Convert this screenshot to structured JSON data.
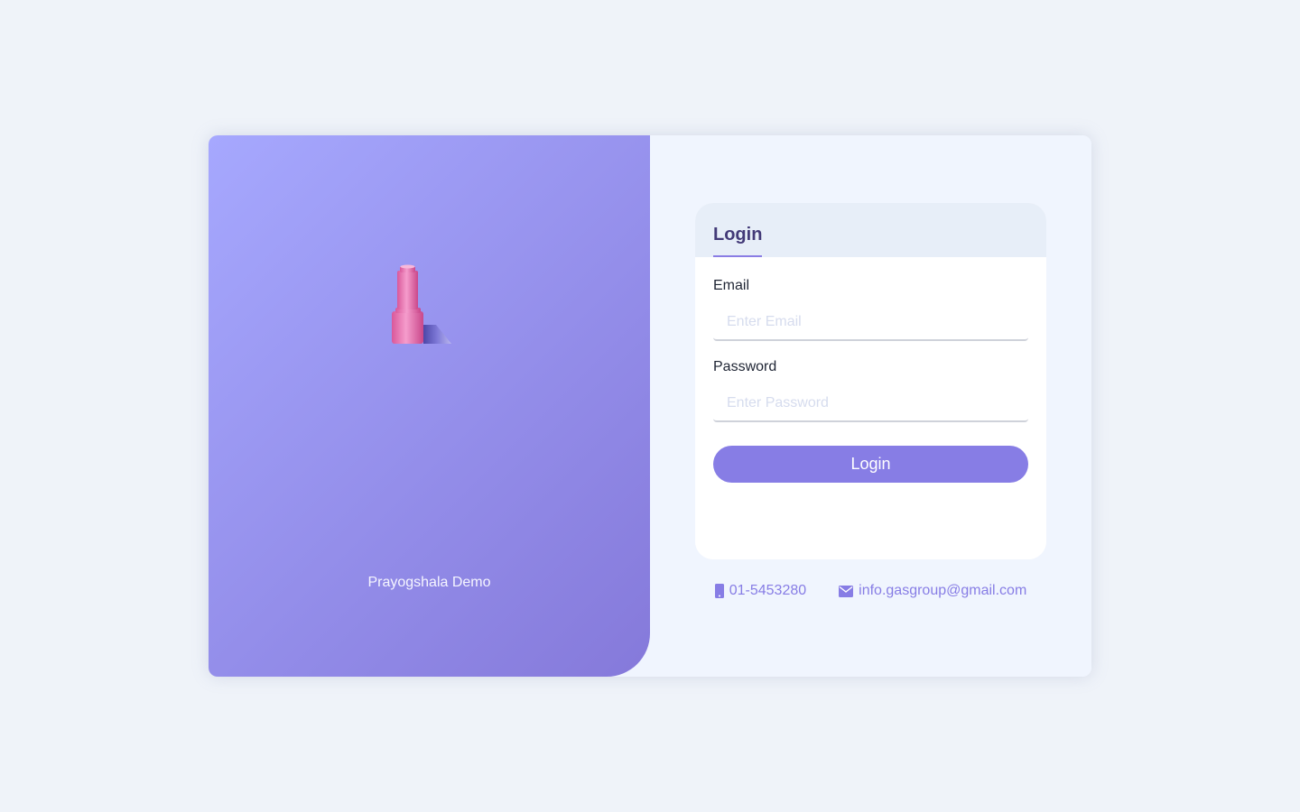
{
  "brand": {
    "name": "Prayogshala Demo"
  },
  "login": {
    "tab_title": "Login",
    "email_label": "Email",
    "email_placeholder": "Enter Email",
    "email_value": "",
    "password_label": "Password",
    "password_placeholder": "Enter Password",
    "password_value": "",
    "submit_label": "Login"
  },
  "contact": {
    "phone": "01-5453280",
    "email": "info.gasgroup@gmail.com"
  },
  "colors": {
    "accent": "#877de5",
    "panel_gradient_start": "#a6a8fe",
    "panel_gradient_end": "#8579da",
    "title": "#433a78"
  },
  "icons": {
    "logo": "gas-cylinder-logo-icon",
    "phone": "mobile-phone-icon",
    "email": "envelope-icon"
  }
}
